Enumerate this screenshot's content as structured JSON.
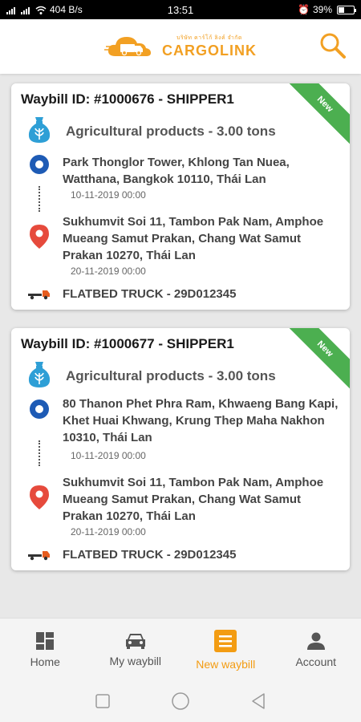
{
  "status_bar": {
    "speed": "404 B/s",
    "time": "13:51",
    "battery": "39%"
  },
  "header": {
    "logo_tagline": "บริษัท คาร์โก้ ลิงค์ จำกัด",
    "logo_name": "CARGOLINK"
  },
  "colors": {
    "accent": "#f39c12",
    "new_ribbon": "#4caf50",
    "goods_icon": "#2e9fd6",
    "origin_icon": "#1e5bb5",
    "destination_icon": "#e64a3c"
  },
  "waybills": [
    {
      "title": "Waybill ID: #1000676 - SHIPPER1",
      "badge": "New",
      "goods": "Agricultural products - 3.00 tons",
      "origin_address": "Park Thonglor Tower, Khlong Tan Nuea, Watthana, Bangkok 10110, Thái Lan",
      "origin_date": "10-11-2019 00:00",
      "destination_address": "Sukhumvit Soi 11, Tambon Pak Nam, Amphoe Mueang Samut Prakan, Chang Wat Samut Prakan 10270, Thái Lan",
      "destination_date": "20-11-2019 00:00",
      "truck": "FLATBED TRUCK - 29D012345"
    },
    {
      "title": "Waybill ID: #1000677 - SHIPPER1",
      "badge": "New",
      "goods": "Agricultural products - 3.00 tons",
      "origin_address": "80 Thanon Phet Phra Ram, Khwaeng Bang Kapi, Khet Huai Khwang, Krung Thep Maha Nakhon 10310, Thái Lan",
      "origin_date": "10-11-2019 00:00",
      "destination_address": "Sukhumvit Soi 11, Tambon Pak Nam, Amphoe Mueang Samut Prakan, Chang Wat Samut Prakan 10270, Thái Lan",
      "destination_date": "20-11-2019 00:00",
      "truck": "FLATBED TRUCK - 29D012345"
    }
  ],
  "bottom_nav": {
    "home": "Home",
    "my_waybill": "My waybill",
    "new_waybill": "New waybill",
    "account": "Account"
  }
}
